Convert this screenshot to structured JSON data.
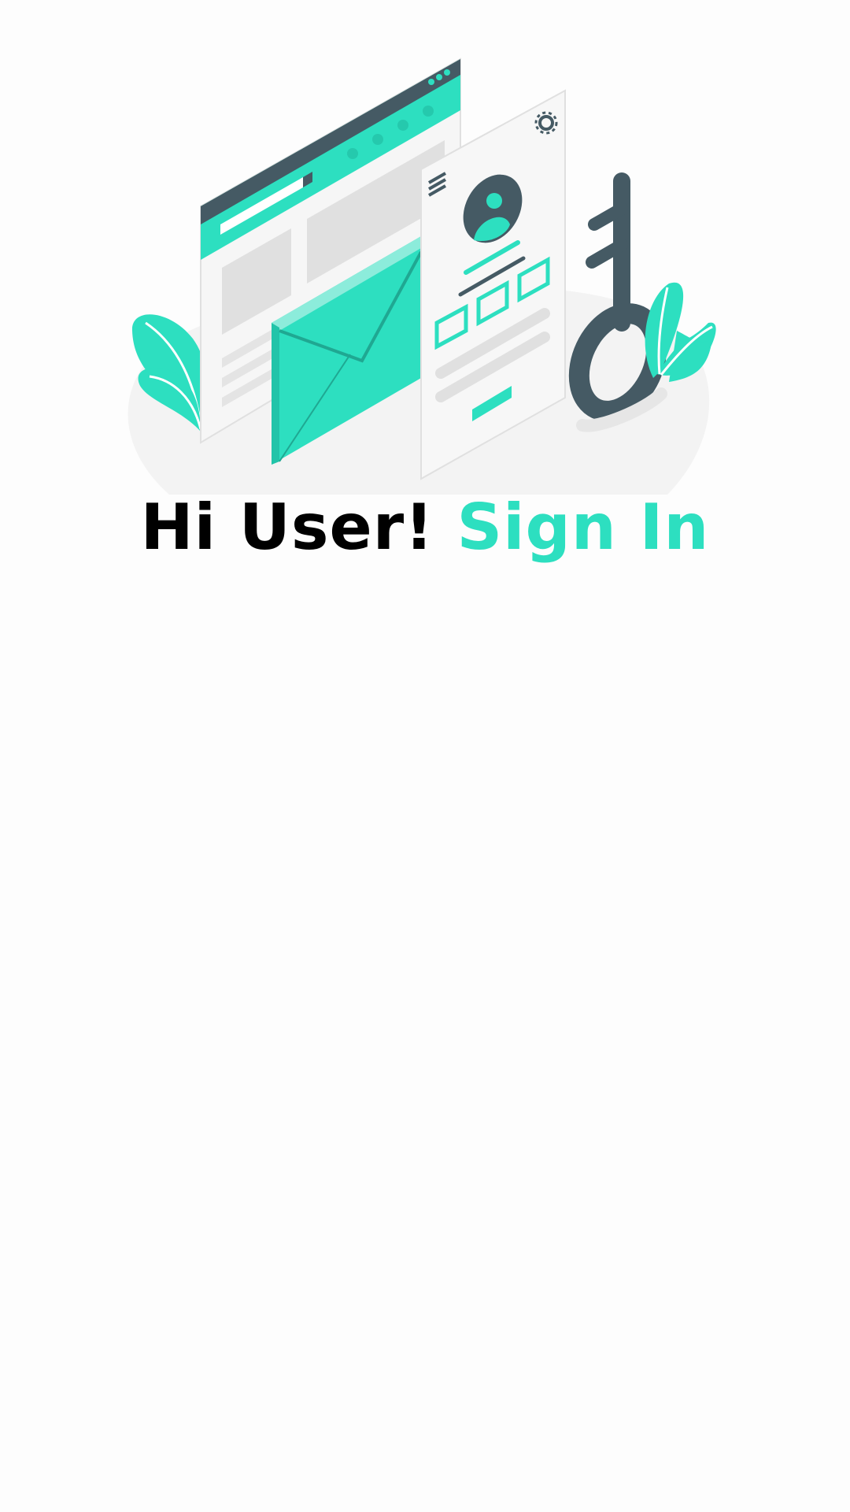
{
  "colors": {
    "accent": "#2ddfc0",
    "dark": "#455a64",
    "background": "#fdfdfd"
  },
  "illustration": {
    "icons": [
      "browser-window-icon",
      "envelope-icon",
      "login-form-icon",
      "key-icon",
      "plant-leaves-icon",
      "gear-icon",
      "menu-icon",
      "user-avatar-icon"
    ]
  },
  "heading": {
    "greeting": "Hi User!",
    "action": "Sign In"
  }
}
